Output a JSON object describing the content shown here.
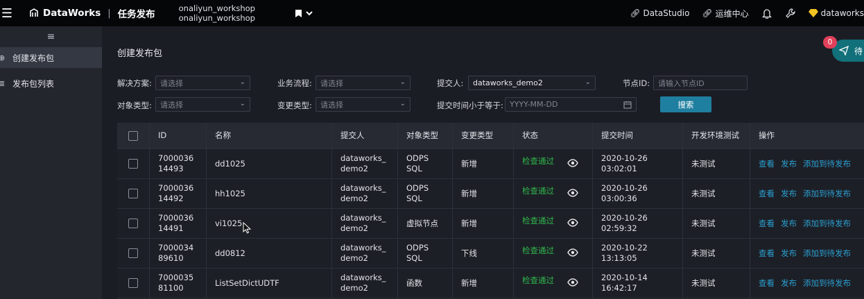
{
  "topbar": {
    "product": "DataWorks",
    "separator": "|",
    "app_title": "任务发布",
    "workspace_line1": "onaliyun_workshop",
    "workspace_line2": "onaliyun_workshop",
    "links": [
      "DataStudio",
      "运维中心"
    ],
    "user": "dataworks"
  },
  "sidebar": {
    "items": [
      {
        "label": "创建发布包",
        "active": true
      },
      {
        "label": "发布包列表",
        "active": false
      }
    ]
  },
  "main": {
    "title": "创建发布包",
    "filters": {
      "solution_label": "解决方案:",
      "solution_placeholder": "请选择",
      "workflow_label": "业务流程:",
      "workflow_placeholder": "请选择",
      "submitter_label": "提交人:",
      "submitter_value": "dataworks_demo2",
      "node_label": "节点ID:",
      "node_placeholder": "请输入节点ID",
      "object_type_label": "对象类型:",
      "object_type_placeholder": "请选择",
      "change_type_label": "变更类型:",
      "change_type_placeholder": "请选择",
      "time_label": "提交时间小于等于:",
      "time_placeholder": "YYYY-MM-DD",
      "search_label": "搜索"
    },
    "table": {
      "headers": [
        "ID",
        "名称",
        "提交人",
        "对象类型",
        "变更类型",
        "状态",
        "提交时间",
        "开发环境测试",
        "操作"
      ],
      "rows": [
        {
          "id1": "7000036",
          "id2": "14493",
          "name": "dd1025",
          "sub1": "dataworks_",
          "sub2": "demo2",
          "ot1": "ODPS",
          "ot2": "SQL",
          "ctype": "新增",
          "status": "检查通过",
          "t1": "2020-10-26",
          "t2": "03:02:01",
          "dev": "未测试"
        },
        {
          "id1": "7000036",
          "id2": "14492",
          "name": "hh1025",
          "sub1": "dataworks_",
          "sub2": "demo2",
          "ot1": "ODPS",
          "ot2": "SQL",
          "ctype": "新增",
          "status": "检查通过",
          "t1": "2020-10-26",
          "t2": "03:00:36",
          "dev": "未测试"
        },
        {
          "id1": "7000036",
          "id2": "14491",
          "name": "vi1025",
          "sub1": "dataworks_",
          "sub2": "demo2",
          "ot1": "虚拟节点",
          "ot2": "",
          "ctype": "新增",
          "status": "检查通过",
          "t1": "2020-10-26",
          "t2": "02:59:32",
          "dev": "未测试"
        },
        {
          "id1": "7000034",
          "id2": "89610",
          "name": "dd0812",
          "sub1": "dataworks_",
          "sub2": "demo2",
          "ot1": "ODPS",
          "ot2": "SQL",
          "ctype": "下线",
          "status": "检查通过",
          "t1": "2020-10-22",
          "t2": "13:13:05",
          "dev": "未测试"
        },
        {
          "id1": "7000035",
          "id2": "81100",
          "name": "ListSetDictUDTF",
          "sub1": "dataworks_",
          "sub2": "demo2",
          "ot1": "函数",
          "ot2": "",
          "ctype": "新增",
          "status": "检查通过",
          "t1": "2020-10-14",
          "t2": "16:42:17",
          "dev": "未测试"
        }
      ],
      "ops": [
        "查看",
        "发布",
        "添加到待发布"
      ]
    }
  },
  "float": {
    "badge": "0",
    "label": "待"
  },
  "colors": {
    "accent": "#1f7fa0",
    "link": "#2a9fd0",
    "status_ok": "#2fb84c",
    "badge": "#e0405a"
  }
}
